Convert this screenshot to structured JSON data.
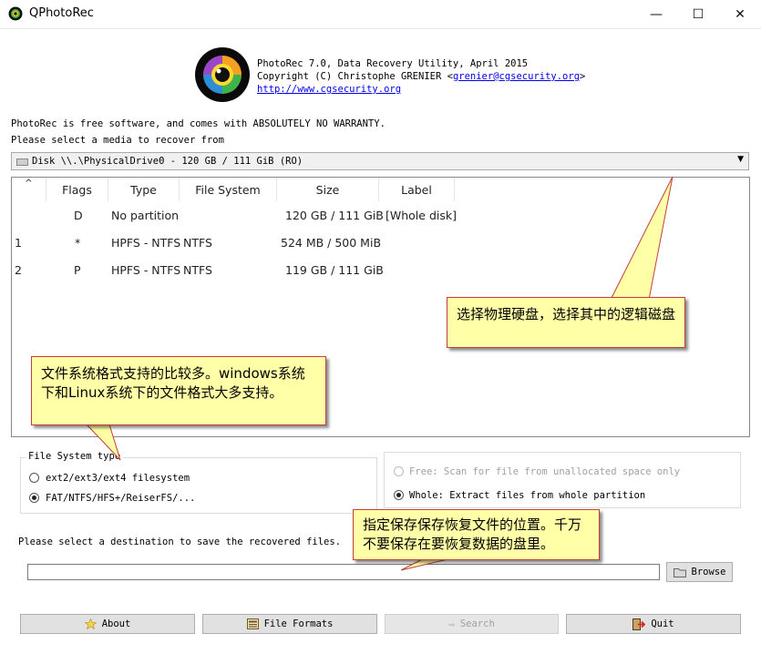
{
  "window": {
    "title": "QPhotoRec",
    "minimize_glyph": "—",
    "maximize_glyph": "☐",
    "close_glyph": "✕"
  },
  "header": {
    "line1": "PhotoRec 7.0, Data Recovery Utility, April 2015",
    "line2_prefix": "Copyright (C) Christophe GRENIER <",
    "email": "grenier@cgsecurity.org",
    "line2_suffix": ">",
    "url": "http://www.cgsecurity.org"
  },
  "notice": "PhotoRec is free software, and comes with ABSOLUTELY NO WARRANTY.",
  "select_media_label": "Please select a media to recover from",
  "disk_select": {
    "value": "Disk \\\\.\\PhysicalDrive0 - 120 GB / 111 GiB (RO)"
  },
  "table": {
    "sort_glyph": "^",
    "columns": [
      "Flags",
      "Type",
      "File System",
      "Size",
      "Label"
    ],
    "rows": [
      {
        "num": "",
        "flags": "D",
        "type": "No partition",
        "fs": "",
        "size": "120 GB / 111 GiB",
        "label": "[Whole disk]"
      },
      {
        "num": "1",
        "flags": "*",
        "type": "HPFS - NTFS",
        "fs": "NTFS",
        "size": "524 MB / 500 MiB",
        "label": ""
      },
      {
        "num": "2",
        "flags": "P",
        "type": "HPFS - NTFS",
        "fs": "NTFS",
        "size": "119 GB / 111 GiB",
        "label": ""
      }
    ]
  },
  "callouts": {
    "disk": "选择物理硬盘，选择其中的逻辑磁盘",
    "fs": "文件系统格式支持的比较多。windows系统下和Linux系统下的文件格式大多支持。",
    "dest": "指定保存保存恢复文件的位置。千万不要保存在要恢复数据的盘里。"
  },
  "fs_group": {
    "title": "File System type",
    "options": [
      "ext2/ext3/ext4 filesystem",
      "FAT/NTFS/HFS+/ReiserFS/..."
    ],
    "selected": 1
  },
  "scan_group": {
    "options": [
      "Free: Scan for file from unallocated space only",
      "Whole: Extract files from whole partition"
    ],
    "selected": 1
  },
  "destination": {
    "label": "Please select a destination to save the recovered files.",
    "value": "",
    "browse": "Browse"
  },
  "buttons": {
    "about": "About",
    "formats": "File Formats",
    "search": "Search",
    "quit": "Quit"
  },
  "colors": {
    "callout_bg": "#ffffa8",
    "callout_border": "#c04040"
  }
}
